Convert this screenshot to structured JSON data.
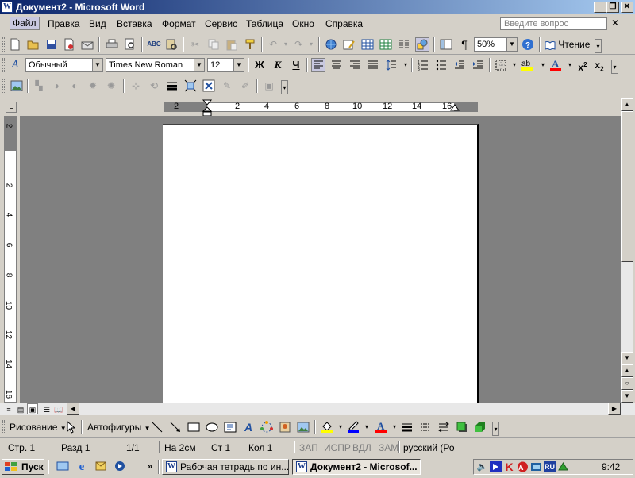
{
  "window": {
    "title": "Документ2 - Microsoft Word",
    "app_icon_glyph": "W",
    "buttons": {
      "minimize": "_",
      "restore": "❐",
      "close": "✕"
    }
  },
  "menubar": {
    "items": [
      "Файл",
      "Правка",
      "Вид",
      "Вставка",
      "Формат",
      "Сервис",
      "Таблица",
      "Окно",
      "Справка"
    ],
    "active_index": 0,
    "help_placeholder": "Введите вопрос",
    "doc_close": "✕"
  },
  "standard_toolbar": {
    "zoom": "50%",
    "reading_label": "Чтение",
    "icons": [
      "new-icon",
      "open-icon",
      "save-icon",
      "permission-icon",
      "email-icon",
      "print-icon",
      "print-preview-icon",
      "spelling-icon",
      "research-icon",
      "cut-icon",
      "copy-icon",
      "paste-icon",
      "format-painter-icon",
      "undo-icon",
      "redo-icon",
      "hyperlink-icon",
      "tables-borders-icon",
      "insert-table-icon",
      "insert-excel-icon",
      "columns-icon",
      "drawing-icon",
      "document-map-icon",
      "show-hide-icon",
      "help-icon"
    ]
  },
  "formatting_toolbar": {
    "style": "Обычный",
    "font": "Times New Roman",
    "size": "12",
    "bold": "Ж",
    "italic": "К",
    "underline": "Ч",
    "highlight_color": "#ffff00",
    "font_color": "#ff0000"
  },
  "picture_toolbar": {
    "icons": [
      "insert-picture-icon",
      "color-icon",
      "more-contrast-icon",
      "less-contrast-icon",
      "more-brightness-icon",
      "less-brightness-icon",
      "crop-icon",
      "rotate-icon",
      "line-style-icon",
      "compress-icon",
      "text-wrapping-icon",
      "format-picture-icon",
      "set-transparent-icon",
      "reset-picture-icon"
    ]
  },
  "ruler": {
    "horizontal_ticks": [
      "2",
      "2",
      "4",
      "6",
      "8",
      "10",
      "12",
      "14",
      "16"
    ],
    "vertical_ticks": [
      "2",
      "2",
      "4",
      "6",
      "8",
      "10",
      "12",
      "14",
      "16"
    ],
    "tab_selector": "L"
  },
  "drawing_toolbar": {
    "drawing_label": "Рисование",
    "autoshapes_label": "Автофигуры",
    "fill_color": "#ffff00",
    "line_color": "#0000ff",
    "font_color": "#ff0000"
  },
  "statusbar": {
    "page": "Стр. 1",
    "section": "Разд 1",
    "pages": "1/1",
    "at": "На 2см",
    "line": "Ст 1",
    "col": "Кол 1",
    "rec": "ЗАП",
    "trk": "ИСПР",
    "ext": "ВДЛ",
    "ovr": "ЗАМ",
    "language": "русский (Ро"
  },
  "taskbar": {
    "start_label": "Пуск",
    "tasks": [
      {
        "label": "Рабочая тетрадь по ин...",
        "active": false
      },
      {
        "label": "Документ2 - Microsof...",
        "active": true
      }
    ],
    "tray_lang": "RU",
    "clock": "9:42"
  }
}
